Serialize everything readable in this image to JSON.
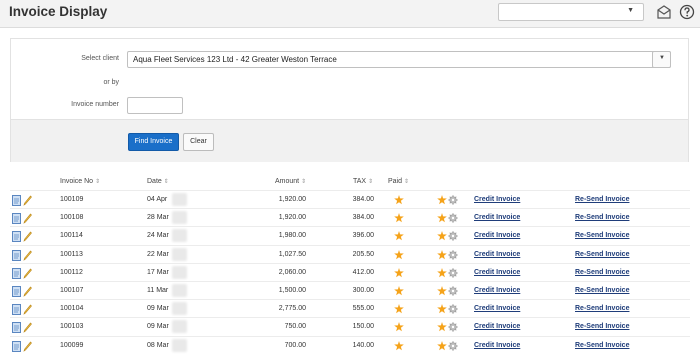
{
  "header": {
    "title": "Invoice Display",
    "select_value": "",
    "icons": [
      "mail-icon",
      "help-icon"
    ]
  },
  "search": {
    "client_label": "Select client",
    "client_value": "Aqua Fleet Services 123 Ltd - 42 Greater Weston Terrace",
    "or_label": "or by",
    "invoice_label": "Invoice number",
    "invoice_value": "",
    "find_label": "Find Invoice",
    "clear_label": "Clear"
  },
  "table": {
    "columns": [
      "Invoice No",
      "Date",
      "Amount",
      "TAX",
      "Paid"
    ],
    "credit_label": "Credit Invoice",
    "resend_label": "Re-Send Invoice",
    "rows": [
      {
        "invoice": "100109",
        "date": "04 Apr",
        "amount": "1,920.00",
        "tax": "384.00"
      },
      {
        "invoice": "100108",
        "date": "28 Mar",
        "amount": "1,920.00",
        "tax": "384.00"
      },
      {
        "invoice": "100114",
        "date": "24 Mar",
        "amount": "1,980.00",
        "tax": "396.00"
      },
      {
        "invoice": "100113",
        "date": "22 Mar",
        "amount": "1,027.50",
        "tax": "205.50"
      },
      {
        "invoice": "100112",
        "date": "17 Mar",
        "amount": "2,060.00",
        "tax": "412.00"
      },
      {
        "invoice": "100107",
        "date": "11 Mar",
        "amount": "1,500.00",
        "tax": "300.00"
      },
      {
        "invoice": "100104",
        "date": "09 Mar",
        "amount": "2,775.00",
        "tax": "555.00"
      },
      {
        "invoice": "100103",
        "date": "09 Mar",
        "amount": "750.00",
        "tax": "150.00"
      },
      {
        "invoice": "100099",
        "date": "08 Mar",
        "amount": "700.00",
        "tax": "140.00"
      }
    ]
  },
  "colors": {
    "accent": "#1a6fc9",
    "paid_icon": "#f5a31a",
    "link": "#1f3d7a"
  }
}
